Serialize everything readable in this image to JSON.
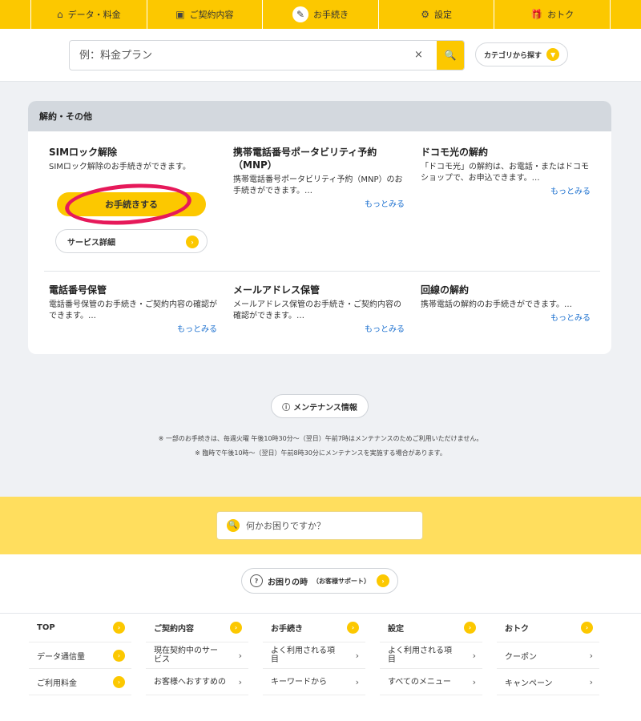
{
  "topnav": {
    "tabs": [
      {
        "label": "データ・料金",
        "icon": "home-icon"
      },
      {
        "label": "ご契約内容",
        "icon": "contract-icon"
      },
      {
        "label": "お手続き",
        "icon": "edit-icon"
      },
      {
        "label": "設定",
        "icon": "gear-icon"
      },
      {
        "label": "おトク",
        "icon": "gift-icon"
      }
    ],
    "active_index": 2
  },
  "search": {
    "placeholder": "例：料金プラン",
    "clear_glyph": "×",
    "category_button": "カテゴリから探す"
  },
  "card": {
    "header": "解約・その他",
    "items": [
      {
        "title": "SIMロック解除",
        "desc": "SIMロック解除のお手続きができます。",
        "more": ""
      },
      {
        "title": "携帯電話番号ポータビリティ予約（MNP）",
        "desc": "携帯電話番号ポータビリティ予約（MNP）のお手続きができます。…",
        "more": "もっとみる"
      },
      {
        "title": "ドコモ光の解約",
        "desc": "「ドコモ光」の解約は、お電話・またはドコモショップで、お申込できます。…",
        "more": "もっとみる"
      },
      {
        "title": "電話番号保管",
        "desc": "電話番号保管のお手続き・ご契約内容の確認ができます。…",
        "more": "もっとみる"
      },
      {
        "title": "メールアドレス保管",
        "desc": "メールアドレス保管のお手続き・ご契約内容の確認ができます。…",
        "more": "もっとみる"
      },
      {
        "title": "回線の解約",
        "desc": "携帯電話の解約のお手続きができます。…",
        "more": "もっとみる"
      }
    ],
    "primary_button": "お手続きする",
    "detail_button": "サービス詳細"
  },
  "maintenance": {
    "button": "メンテナンス情報",
    "note1": "※ 一部のお手続きは、毎週火曜 午後10時30分～（翌日）午前7時はメンテナンスのためご利用いただけません。",
    "note2": "※ 臨時で午後10時～（翌日）午前8時30分にメンテナンスを実施する場合があります。"
  },
  "help": {
    "placeholder": "何かお困りですか？"
  },
  "support": {
    "label": "お困りの時",
    "sub": "（お客様サポート）"
  },
  "footer": {
    "columns": [
      {
        "head": "TOP",
        "rows": [
          "データ通信量",
          "ご利用料金"
        ]
      },
      {
        "head": "ご契約内容",
        "rows": [
          "現在契約中のサービス",
          "お客様へおすすめの"
        ]
      },
      {
        "head": "お手続き",
        "rows": [
          "よく利用される項目",
          "キーワードから"
        ]
      },
      {
        "head": "設定",
        "rows": [
          "よく利用される項目",
          "すべてのメニュー"
        ]
      },
      {
        "head": "おトク",
        "rows": [
          "クーポン",
          "キャンペーン"
        ]
      }
    ]
  },
  "colors": {
    "accent": "#fcc800",
    "highlight_circle": "#e6195a",
    "link": "#1a6fcf"
  }
}
